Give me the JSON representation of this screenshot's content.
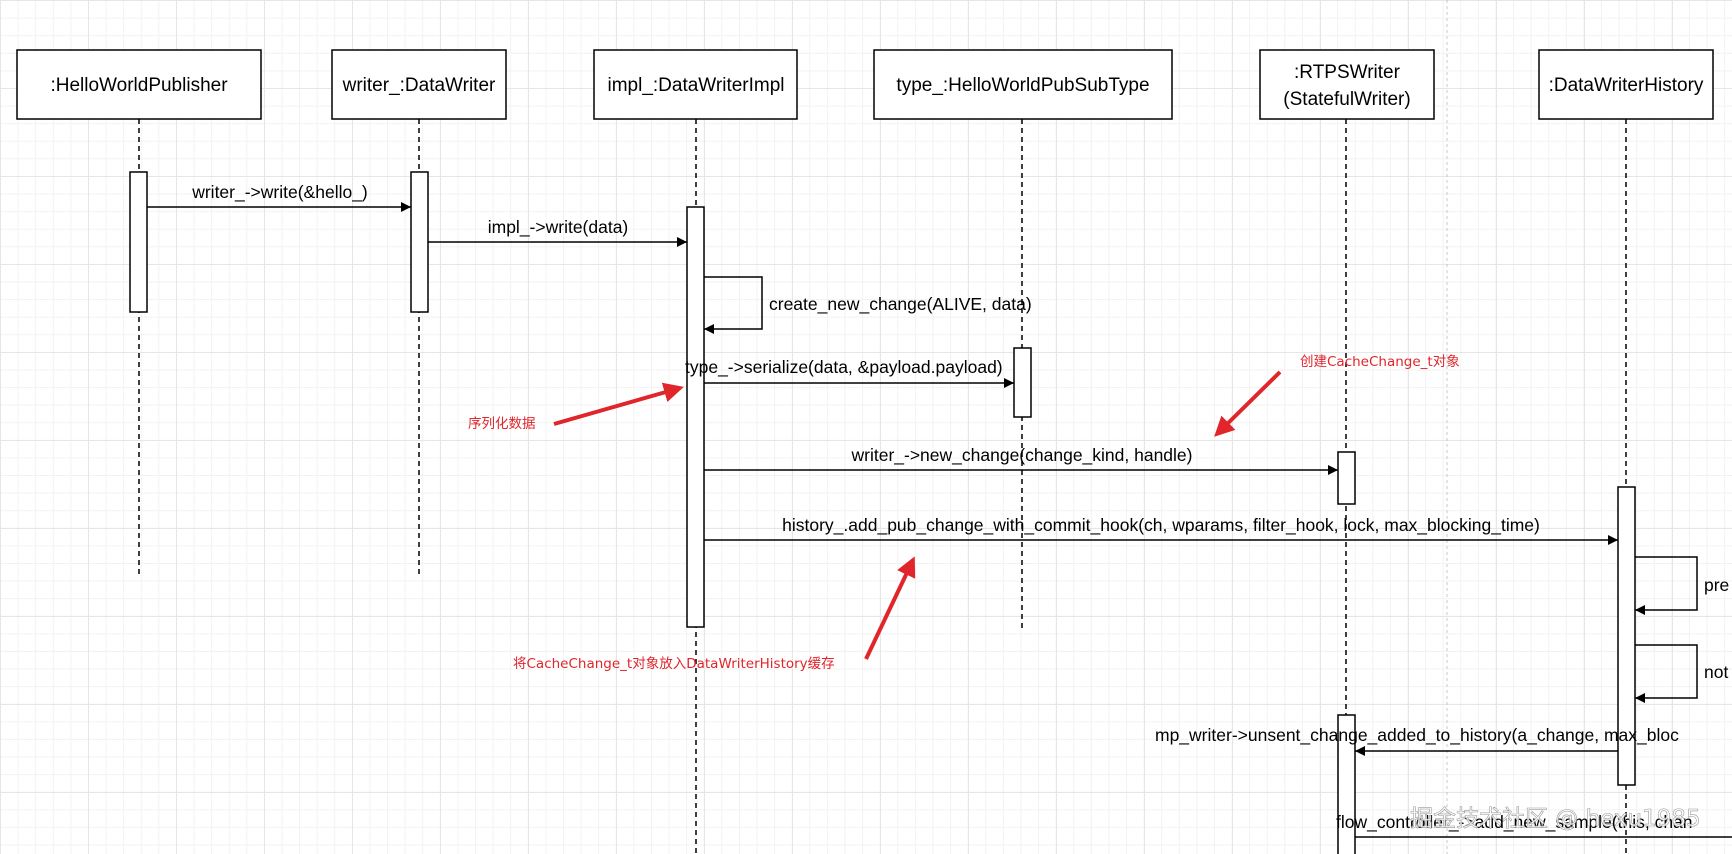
{
  "participants": [
    {
      "id": "publisher",
      "label": ":HelloWorldPublisher"
    },
    {
      "id": "writer",
      "label": "writer_:DataWriter"
    },
    {
      "id": "impl",
      "label": "impl_:DataWriterImpl"
    },
    {
      "id": "type",
      "label": "type_:HelloWorldPubSubType"
    },
    {
      "id": "rtps",
      "label_line1": ":RTPSWriter",
      "label_line2": "(StatefulWriter)"
    },
    {
      "id": "history",
      "label": ":DataWriterHistory"
    }
  ],
  "messages": [
    {
      "label": "writer_->write(&hello_)"
    },
    {
      "label": "impl_->write(data)"
    },
    {
      "label": "create_new_change(ALIVE, data)"
    },
    {
      "label": "type_->serialize(data, &payload.payload)"
    },
    {
      "label": "writer_->new_change(change_kind, handle)"
    },
    {
      "label": "history_.add_pub_change_with_commit_hook(ch, wparams, filter_hook, lock, max_blocking_time)"
    },
    {
      "label": "pre"
    },
    {
      "label": "not"
    },
    {
      "label": "mp_writer->unsent_change_added_to_history(a_change, max_bloc"
    },
    {
      "label": "flow_controller_->add_new_sample(this, chan"
    }
  ],
  "annotations": [
    {
      "text": "创建CacheChange_t对象"
    },
    {
      "text": "序列化数据"
    },
    {
      "text": "将CacheChange_t对象放入DataWriterHistory缓存"
    }
  ],
  "watermark": {
    "text": "掘金技术社区 @ hexu1985"
  },
  "colors": {
    "annotation": "#e0262b",
    "grid": "#e6e6e6",
    "stroke": "#000000"
  }
}
